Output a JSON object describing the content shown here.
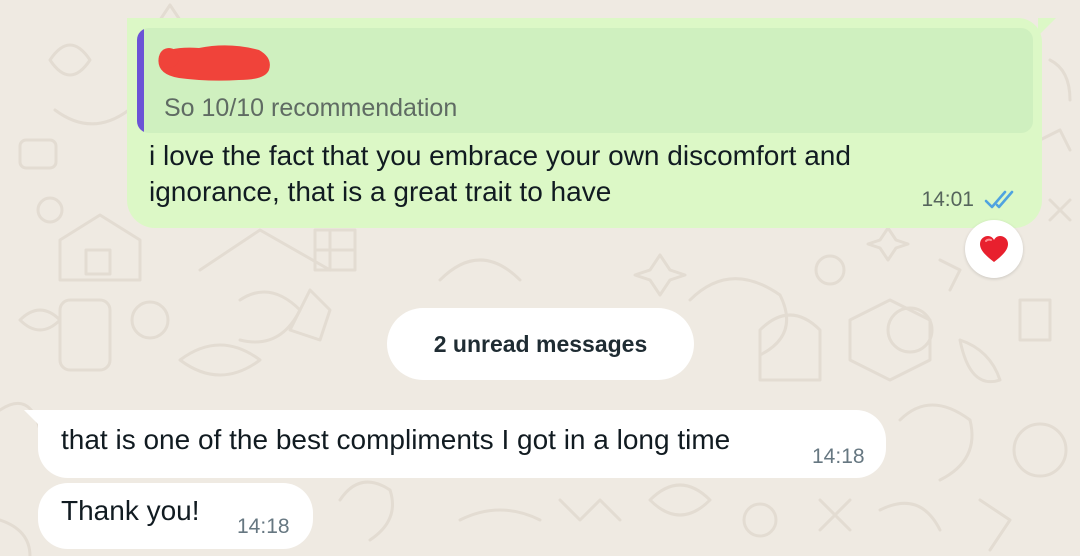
{
  "theme": {
    "chat_background": "#efeae2",
    "outgoing_bubble": "#dcf8c6",
    "quote_background": "#cff0bf",
    "quote_bar": "#6b53d6",
    "incoming_bubble": "#ffffff",
    "read_ticks": "#4fa3e0",
    "redaction": "#f0433a"
  },
  "outgoing_message": {
    "quoted_reply": {
      "author_name": "",
      "author_redacted": true,
      "text": "So 10/10 recommendation"
    },
    "text": "i love the fact that you embrace your own discomfort and ignorance, that is a great trait to have",
    "time": "14:01",
    "status_icon": "double-check-read-icon",
    "reaction": "heart-emoji"
  },
  "unread_divider": {
    "label": "2 unread messages"
  },
  "incoming_messages": [
    {
      "text": "that is one of the best compliments I got in a long time",
      "time": "14:18"
    },
    {
      "text": "Thank you!",
      "time": "14:18"
    }
  ]
}
